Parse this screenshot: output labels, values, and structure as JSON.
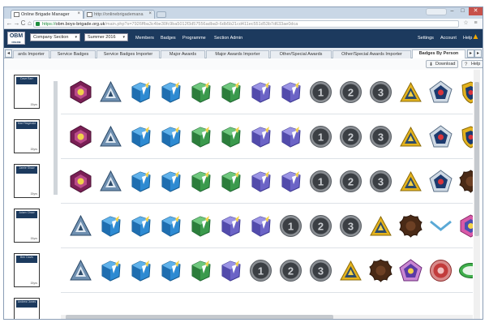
{
  "browser": {
    "tabs": [
      {
        "title": "Online Brigade Manager",
        "active": true
      },
      {
        "title": "http://onlinebrigademana",
        "active": false
      }
    ],
    "user_button": "",
    "window_controls": [
      "–",
      "□",
      "✕"
    ],
    "address": {
      "scheme": "https://",
      "host": "obm.boys-brigade.org.uk",
      "path": "/main.php?s=7926ffba3c4be30fc9ba5012f3d57556adba9-6db5b21cd411ec551d53b7d633ae0dca"
    },
    "nav": {
      "back": "←",
      "forward": "→",
      "reload": "C",
      "home": "⌂"
    },
    "toolbar_icons": {
      "star": "☆",
      "menu": "≡"
    }
  },
  "app": {
    "logo": "OBM",
    "logo_sub": "ONLINE BRIGADE MANAGER",
    "section_select": "Company Section",
    "session_select": "Summer 2016",
    "nav_links": [
      "Members",
      "Badges",
      "Programme",
      "Section Admin"
    ],
    "right_links": [
      "Settings",
      "Account",
      "Help"
    ]
  },
  "badge_tabs": [
    "ards Importer",
    "Service Badges",
    "Service Badges Importer",
    "Major Awards",
    "Major Awards Importer",
    "Other/Special Awards",
    "Other/Special Awards Importer",
    "Badges By Person"
  ],
  "active_badge_tab": "Badges By Person",
  "tab_arrows": {
    "left": "◂",
    "right": "▸",
    "more": "▸"
  },
  "actions": {
    "download": "Download",
    "help": "Help"
  },
  "people": [
    {
      "name": "Dave Barr",
      "years": "15yrs"
    },
    {
      "name": "Mat Fitzgerald",
      "years": "15yrs"
    },
    {
      "name": "Jamie Shaw",
      "years": "15yrs"
    },
    {
      "name": "Adam Chaw",
      "years": "15yrs"
    },
    {
      "name": "Ben Davis",
      "years": "15yrs"
    },
    {
      "name": "Andrew Jones",
      "years": ""
    }
  ],
  "badge_rows": [
    [
      "hex-maroon",
      "tri-blue",
      "cube",
      "cube",
      "cube-green",
      "cube-green",
      "cube-purple",
      "cube-purple",
      "circle-1",
      "circle-2",
      "circle-3",
      "tri-gold",
      "pent-blue",
      "shield-red"
    ],
    [
      "hex-maroon",
      "tri-blue",
      "cube",
      "cube",
      "cube-green",
      "cube-green",
      "cube-purple",
      "cube-purple",
      "circle-1",
      "circle-2",
      "circle-3",
      "tri-gold",
      "pent-blue",
      "shield-red"
    ],
    [
      "hex-maroon",
      "tri-blue",
      "cube",
      "cube",
      "cube-green",
      "cube-green",
      "cube-purple",
      "cube-purple",
      "circle-1",
      "circle-2",
      "circle-3",
      "tri-gold",
      "pent-blue",
      "blob-brown"
    ],
    [
      "tri-blue",
      "cube",
      "cube",
      "cube",
      "cube-green",
      "cube-purple",
      "cube-purple",
      "circle-1",
      "circle-2",
      "circle-3",
      "tri-gold",
      "blob-brown",
      "chevron-blue",
      "hex-pink"
    ],
    [
      "tri-blue",
      "cube",
      "cube",
      "cube",
      "cube-green",
      "cube-purple",
      "circle-1",
      "circle-2",
      "circle-3",
      "tri-gold",
      "blob-brown",
      "pent-purple",
      "round-red",
      "oval-green"
    ]
  ],
  "colors": {
    "nav_bg": "#1c3a5e",
    "accent_bell": "#f2a900"
  }
}
